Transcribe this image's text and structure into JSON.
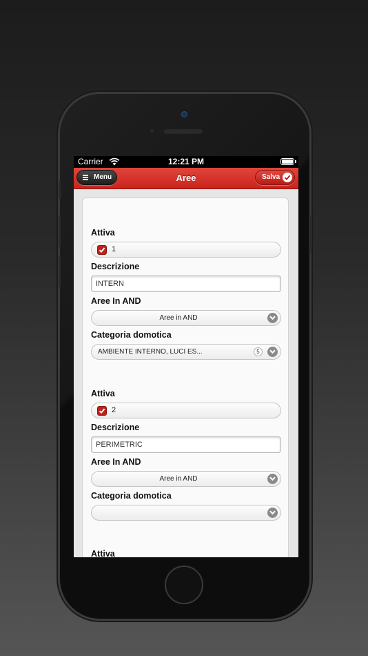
{
  "status_bar": {
    "carrier": "Carrier",
    "time": "12:21 PM"
  },
  "header": {
    "title": "Aree",
    "menu_label": "Menu",
    "save_label": "Salva"
  },
  "colors": {
    "accent": "#c9241d",
    "header_dark": "#1e1e1e"
  },
  "areas": [
    {
      "active_label": "Attiva",
      "active_value": "1",
      "active_checked": true,
      "description_label": "Descrizione",
      "description_value": "INTERN",
      "aree_and_label": "Aree In AND",
      "aree_and_value": "Aree in AND",
      "categoria_label": "Categoria domotica",
      "categoria_value": "AMBIENTE INTERNO, LUCI ES...",
      "categoria_count": "5"
    },
    {
      "active_label": "Attiva",
      "active_value": "2",
      "active_checked": true,
      "description_label": "Descrizione",
      "description_value": "PERIMETRIC",
      "aree_and_label": "Aree In AND",
      "aree_and_value": "Aree in AND",
      "categoria_label": "Categoria domotica",
      "categoria_value": ""
    },
    {
      "active_label": "Attiva"
    }
  ],
  "icons": {
    "menu": "hamburger-icon",
    "save": "checkmark-icon",
    "select": "chevron-down-icon",
    "checkbox": "checkmark-icon"
  }
}
